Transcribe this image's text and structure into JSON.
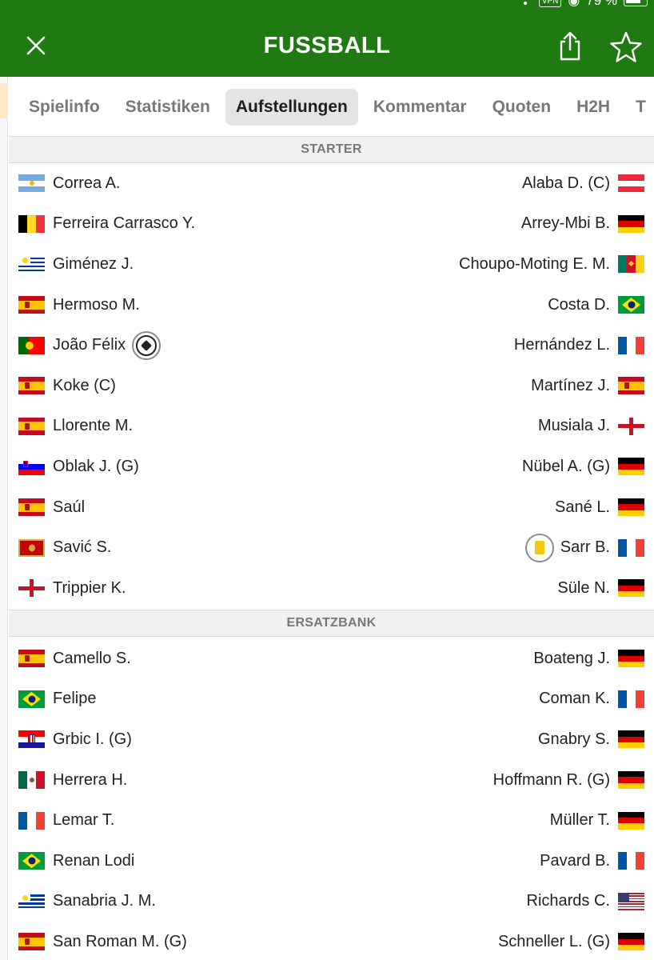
{
  "status": {
    "vpn": "VPN",
    "battery": "79 %"
  },
  "header": {
    "title": "FUSSBALL"
  },
  "tabs": [
    "Spielinfo",
    "Statistiken",
    "Aufstellungen",
    "Kommentar",
    "Quoten",
    "H2H",
    "T"
  ],
  "active_tab": "Aufstellungen",
  "sections": {
    "starter": "STARTER",
    "bench": "ERSATZBANK"
  },
  "colors": {
    "brand_green": "#1f7a11",
    "yellow_card": "#f6c911"
  },
  "starters": [
    {
      "home": {
        "name": "Correa A.",
        "flag": "argentina"
      },
      "away": {
        "name": "Alaba D. (C)",
        "flag": "austria"
      }
    },
    {
      "home": {
        "name": "Ferreira Carrasco Y.",
        "flag": "belgium"
      },
      "away": {
        "name": "Arrey-Mbi B.",
        "flag": "germany"
      }
    },
    {
      "home": {
        "name": "Giménez J.",
        "flag": "uruguay"
      },
      "away": {
        "name": "Choupo-Moting E. M.",
        "flag": "cameroon"
      }
    },
    {
      "home": {
        "name": "Hermoso M.",
        "flag": "spain"
      },
      "away": {
        "name": "Costa D.",
        "flag": "brazil"
      }
    },
    {
      "home": {
        "name": "João Félix",
        "flag": "portugal",
        "event": "goal-icon"
      },
      "away": {
        "name": "Hernández L.",
        "flag": "france"
      }
    },
    {
      "home": {
        "name": "Koke (C)",
        "flag": "spain"
      },
      "away": {
        "name": "Martínez J.",
        "flag": "spain"
      }
    },
    {
      "home": {
        "name": "Llorente M.",
        "flag": "spain"
      },
      "away": {
        "name": "Musiala J.",
        "flag": "england"
      }
    },
    {
      "home": {
        "name": "Oblak J. (G)",
        "flag": "slovenia"
      },
      "away": {
        "name": "Nübel A. (G)",
        "flag": "germany"
      }
    },
    {
      "home": {
        "name": "Saúl",
        "flag": "spain"
      },
      "away": {
        "name": "Sané L.",
        "flag": "germany"
      }
    },
    {
      "home": {
        "name": "Savić S.",
        "flag": "montenegro"
      },
      "away": {
        "name": "Sarr B.",
        "flag": "france",
        "event": "yellow-card-icon"
      }
    },
    {
      "home": {
        "name": "Trippier K.",
        "flag": "england"
      },
      "away": {
        "name": "Süle N.",
        "flag": "germany"
      }
    }
  ],
  "bench": [
    {
      "home": {
        "name": "Camello S.",
        "flag": "spain"
      },
      "away": {
        "name": "Boateng J.",
        "flag": "germany"
      }
    },
    {
      "home": {
        "name": "Felipe",
        "flag": "brazil"
      },
      "away": {
        "name": "Coman K.",
        "flag": "france"
      }
    },
    {
      "home": {
        "name": "Grbic I. (G)",
        "flag": "croatia"
      },
      "away": {
        "name": "Gnabry S.",
        "flag": "germany"
      }
    },
    {
      "home": {
        "name": "Herrera H.",
        "flag": "mexico"
      },
      "away": {
        "name": "Hoffmann R. (G)",
        "flag": "germany"
      }
    },
    {
      "home": {
        "name": "Lemar T.",
        "flag": "france"
      },
      "away": {
        "name": "Müller T.",
        "flag": "germany"
      }
    },
    {
      "home": {
        "name": "Renan Lodi",
        "flag": "brazil"
      },
      "away": {
        "name": "Pavard B.",
        "flag": "france"
      }
    },
    {
      "home": {
        "name": "Sanabria J. M.",
        "flag": "uruguay"
      },
      "away": {
        "name": "Richards C.",
        "flag": "usa"
      }
    },
    {
      "home": {
        "name": "San Roman M. (G)",
        "flag": "spain"
      },
      "away": {
        "name": "Schneller L. (G)",
        "flag": "germany"
      }
    }
  ]
}
